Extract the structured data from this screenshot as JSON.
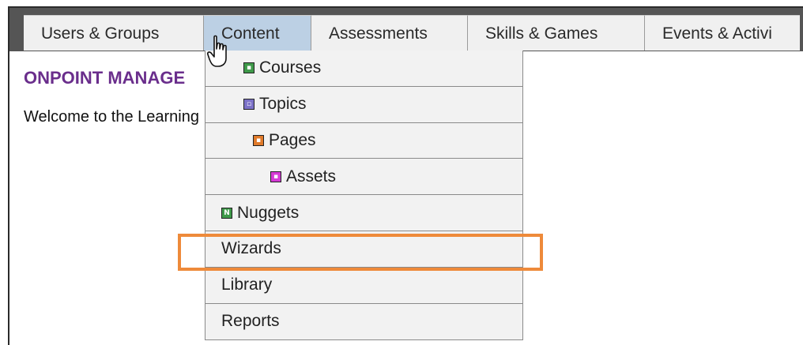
{
  "nav": {
    "tabs": [
      {
        "label": "Users & Groups"
      },
      {
        "label": "Content"
      },
      {
        "label": "Assessments"
      },
      {
        "label": "Skills & Games"
      },
      {
        "label": "Events & Activi"
      }
    ],
    "active_tab": "Content"
  },
  "main": {
    "title": "ONPOINT MANAGE",
    "welcome": "Welcome to the Learning"
  },
  "content_menu": {
    "items": [
      {
        "label": "Courses",
        "icon": "courses-icon"
      },
      {
        "label": "Topics",
        "icon": "topics-icon"
      },
      {
        "label": "Pages",
        "icon": "pages-icon"
      },
      {
        "label": "Assets",
        "icon": "assets-icon"
      },
      {
        "label": "Nuggets",
        "icon": "nuggets-icon"
      },
      {
        "label": "Wizards"
      },
      {
        "label": "Library"
      },
      {
        "label": "Reports"
      }
    ],
    "highlighted_item": "Wizards"
  },
  "colors": {
    "topbar": "#555555",
    "active_tab": "#bcd0e4",
    "title": "#6a2e8c",
    "highlight": "#ee8a3a"
  }
}
